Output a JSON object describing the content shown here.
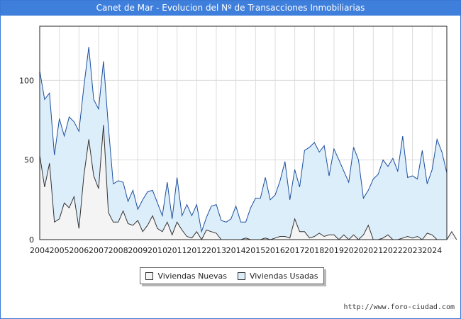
{
  "title": "Canet de Mar - Evolucion del Nº de Transacciones Inmobiliarias",
  "footer": {
    "url": "http://www.foro-ciudad.com"
  },
  "chart_data": {
    "type": "area",
    "x_ticks": [
      "2004",
      "2005",
      "2006",
      "2007",
      "2008",
      "2009",
      "2010",
      "2011",
      "2012",
      "2013",
      "2014",
      "2015",
      "2016",
      "2017",
      "2018",
      "2019",
      "2020",
      "2021",
      "2022",
      "2023",
      "2024"
    ],
    "y_ticks": [
      0,
      50,
      100
    ],
    "ylim": [
      0,
      134
    ],
    "xlim": [
      2004,
      2024.75
    ],
    "grid": true,
    "legend_position": "bottom-center",
    "colors": {
      "usadas_fill": "#ddeefb",
      "usadas_line": "#1b4f9e",
      "nuevas_fill": "#f4f4f4",
      "nuevas_line": "#333333"
    },
    "series": [
      {
        "name": "Viviendas Nuevas",
        "start": 2004,
        "step": 0.25,
        "values": [
          53,
          33,
          48,
          11,
          13,
          23,
          20,
          27,
          7,
          40,
          63,
          40,
          32,
          72,
          17,
          11,
          11,
          18,
          10,
          9,
          12,
          5,
          9,
          15,
          7,
          5,
          11,
          3,
          11,
          6,
          2,
          1,
          5,
          0,
          6,
          5,
          4,
          0,
          0,
          0,
          0,
          0,
          1,
          0,
          0,
          0,
          1,
          0,
          1,
          2,
          2,
          1,
          13,
          5,
          5,
          1,
          2,
          4,
          2,
          3,
          3,
          0,
          3,
          0,
          3,
          0,
          3,
          9,
          0,
          0,
          1,
          3,
          0,
          0,
          1,
          2,
          1,
          2,
          0,
          4,
          3,
          0,
          0,
          0,
          5,
          0
        ]
      },
      {
        "name": "Viviendas Usadas",
        "start": 2004,
        "step": 0.25,
        "values": [
          106,
          88,
          92,
          53,
          76,
          65,
          77,
          74,
          68,
          96,
          121,
          88,
          82,
          112,
          71,
          35,
          37,
          36,
          24,
          31,
          19,
          25,
          30,
          31,
          23,
          15,
          36,
          13,
          39,
          15,
          22,
          15,
          22,
          5,
          14,
          21,
          22,
          12,
          11,
          13,
          21,
          11,
          11,
          20,
          26,
          26,
          39,
          25,
          28,
          37,
          49,
          25,
          44,
          33,
          56,
          58,
          61,
          55,
          59,
          40,
          57,
          50,
          43,
          36,
          58,
          50,
          26,
          31,
          38,
          41,
          50,
          46,
          51,
          43,
          65,
          39,
          40,
          38,
          56,
          35,
          44,
          63,
          55,
          42
        ]
      }
    ]
  }
}
